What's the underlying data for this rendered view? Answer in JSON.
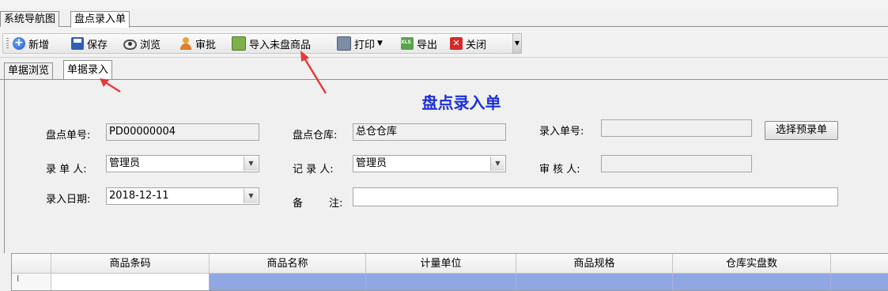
{
  "doc_tabs": [
    {
      "label": "系统导航图",
      "active": false
    },
    {
      "label": "盘点录入单",
      "active": true
    }
  ],
  "toolbar": {
    "new": "新增",
    "save": "保存",
    "browse": "浏览",
    "approve": "审批",
    "import_unchecked": "导入未盘商品",
    "print": "打印",
    "export": "导出",
    "close": "关闭"
  },
  "inner_tabs": [
    {
      "label": "单据浏览",
      "active": false
    },
    {
      "label": "单据录入",
      "active": true
    }
  ],
  "form": {
    "title": "盘点录入单",
    "check_no_label": "盘点单号:",
    "check_no_value": "PD00000004",
    "warehouse_label": "盘点仓库:",
    "warehouse_value": "总仓仓库",
    "entry_no_label": "录入单号:",
    "entry_no_value": "",
    "select_pre_button": "选择预录单",
    "entered_by_label": "录 单 人:",
    "entered_by_value": "管理员",
    "recorder_label": "记 录 人:",
    "recorder_value": "管理员",
    "reviewer_label": "审 核 人:",
    "reviewer_value": "",
    "entry_date_label": "录入日期:",
    "entry_date_value": "2018-12-11",
    "remark_label_a": "备",
    "remark_label_b": "注:",
    "remark_value": ""
  },
  "grid": {
    "columns": [
      "商品条码",
      "商品名称",
      "计量单位",
      "商品规格",
      "仓库实盘数"
    ],
    "row_indicator": "I"
  },
  "colors": {
    "title_blue": "#1c2fd8",
    "selected_cell": "#8fa7e2",
    "annotation_red": "#e53a3a"
  }
}
